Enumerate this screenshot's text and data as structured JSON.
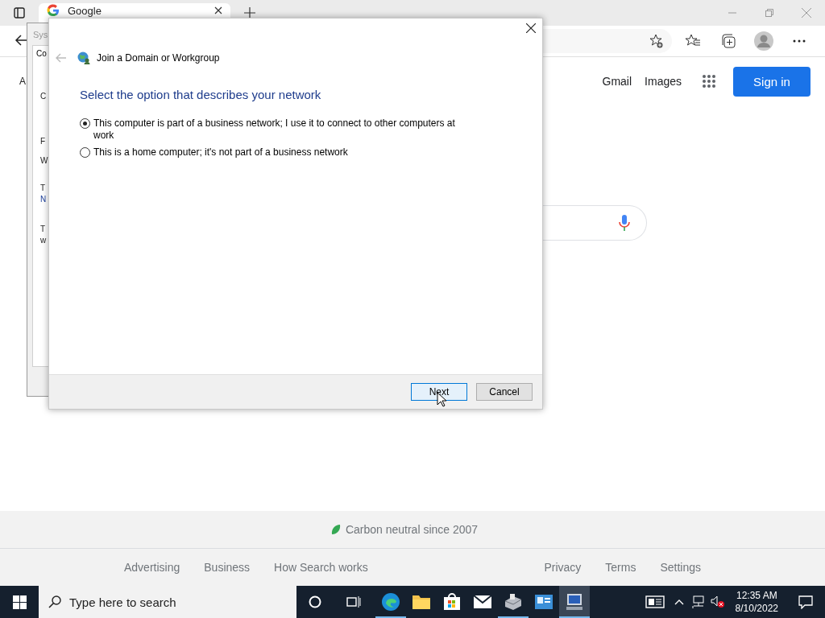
{
  "browser": {
    "tabs": [
      {
        "title": "Google",
        "selected": true
      }
    ],
    "page": {
      "partial_text": "A",
      "header_links": [
        "Gmail",
        "Images"
      ],
      "sign_in": "Sign in",
      "footer": {
        "carbon": "Carbon neutral since 2007",
        "left_links": [
          "Advertising",
          "Business",
          "How Search works"
        ],
        "right_links": [
          "Privacy",
          "Terms",
          "Settings"
        ]
      }
    }
  },
  "system_window": {
    "title": "Sys",
    "tab": "Co",
    "fragments": [
      {
        "text": "C",
        "kind": "text"
      },
      {
        "text": "F",
        "kind": "text"
      },
      {
        "text": "W",
        "kind": "text"
      },
      {
        "text": "T",
        "kind": "text"
      },
      {
        "text": "N",
        "kind": "link"
      },
      {
        "text": "T",
        "kind": "text"
      },
      {
        "text": "w",
        "kind": "text"
      }
    ]
  },
  "dialog": {
    "title": "Join a Domain or Workgroup",
    "heading": "Select the option that describes your network",
    "options": [
      {
        "label": "This computer is part of a business network; I use it to connect to other computers at work",
        "selected": true
      },
      {
        "label": "This is a home computer; it's not part of a business network",
        "selected": false
      }
    ],
    "buttons": [
      {
        "label": "Next",
        "kind": "default"
      },
      {
        "label": "Cancel",
        "kind": "normal"
      }
    ]
  },
  "taskbar": {
    "search_placeholder": "Type here to search",
    "apps": [
      {
        "kind": "edge",
        "running": true,
        "selected": false
      },
      {
        "kind": "explorer",
        "running": false,
        "selected": false
      },
      {
        "kind": "store",
        "running": false,
        "selected": false
      },
      {
        "kind": "mail",
        "running": false,
        "selected": false
      },
      {
        "kind": "drive",
        "running": true,
        "selected": false
      },
      {
        "kind": "panel",
        "running": false,
        "selected": false
      },
      {
        "kind": "monitor",
        "running": true,
        "selected": true
      }
    ],
    "time": "12:35 AM",
    "date": "8/10/2022"
  }
}
